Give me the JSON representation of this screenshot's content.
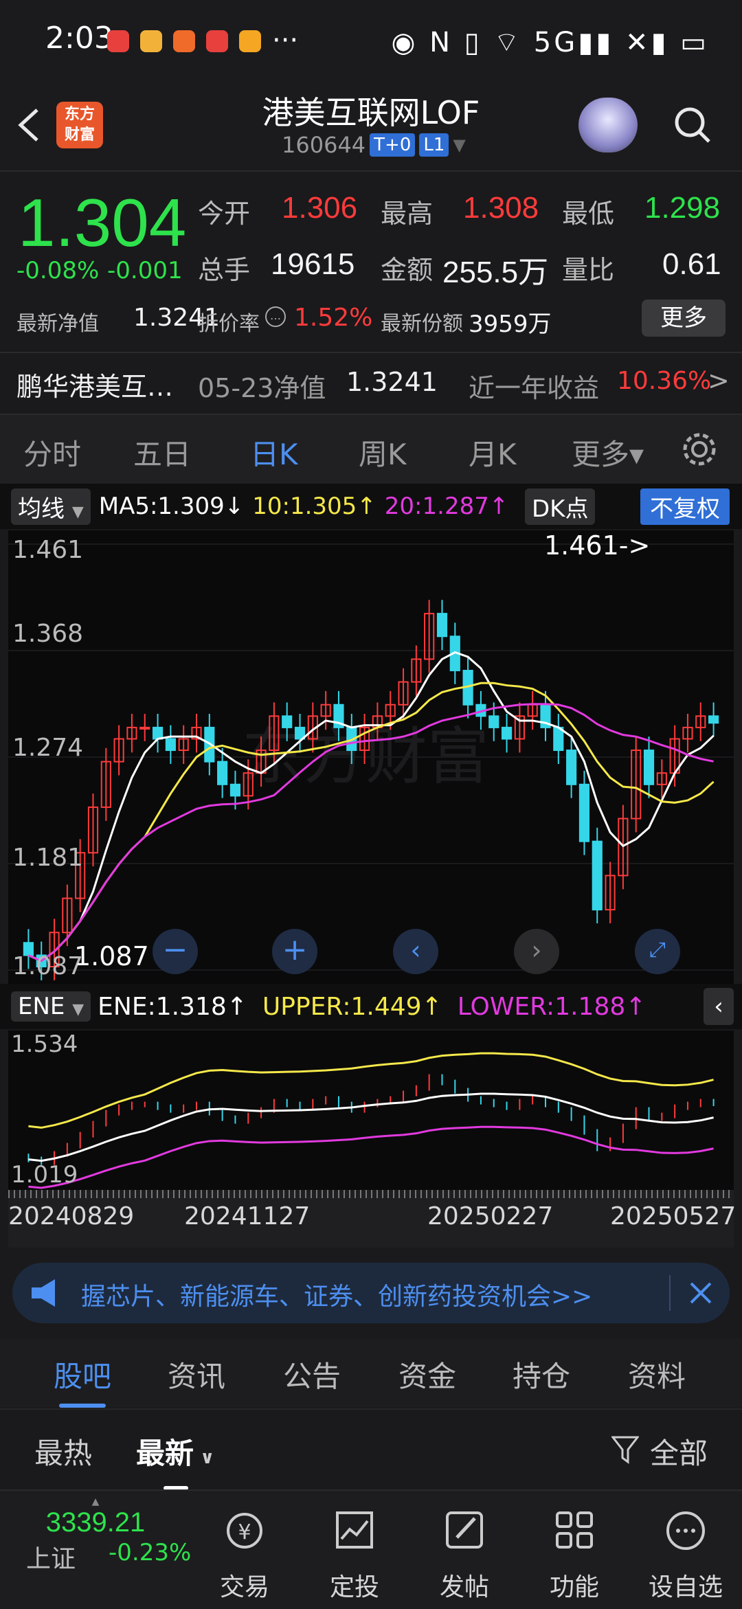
{
  "status": {
    "time": "2:03",
    "dots": "···",
    "icons": "◉ N ▯ ⌔ 5G▮▮ ✕▮ ▭"
  },
  "header": {
    "title": "港美互联网LOF",
    "code": "160644",
    "tag1": "T+0",
    "tag2": "L1",
    "logo_line1": "东方",
    "logo_line2": "财富"
  },
  "quote": {
    "price": "1.304",
    "change_pct": "-0.08%",
    "change": "-0.001",
    "open_label": "今开",
    "open": "1.306",
    "high_label": "最高",
    "high": "1.308",
    "low_label": "最低",
    "low": "1.298",
    "vol_label": "总手",
    "vol": "19615",
    "amt_label": "金额",
    "amt": "255.5万",
    "ratio_label": "量比",
    "ratio": "0.61",
    "nav_label": "最新净值",
    "nav": "1.3241",
    "disc_label": "折价率",
    "disc": "1.52%",
    "share_label": "最新份额",
    "share": "3959万",
    "more": "更多",
    "fund_name": "鹏华港美互…",
    "nav_date_label": "05-23净值",
    "nav_date_val": "1.3241",
    "year_label": "近一年收益",
    "year_val": "10.36%",
    "arrow": ">"
  },
  "period_tabs": [
    "分时",
    "五日",
    "日K",
    "周K",
    "月K",
    "更多▾"
  ],
  "ma": {
    "sel": "均线",
    "ma5": "MA5:1.309↓",
    "ma10": "10:1.305↑",
    "ma20": "20:1.287↑",
    "dk": "DK点",
    "fq": "不复权"
  },
  "kchart": {
    "y_labels": [
      "1.461",
      "1.368",
      "1.274",
      "1.181",
      "1.087"
    ],
    "max_note": "1.461->",
    "min_note": "1.087",
    "watermark": "东方财富"
  },
  "ene": {
    "sel": "ENE",
    "ene": "ENE:1.318↑",
    "upper": "UPPER:1.449↑",
    "lower": "LOWER:1.188↑",
    "y_top": "1.534",
    "y_bot": "1.019"
  },
  "dates": [
    "20240829",
    "20241127",
    "20250227",
    "20250527"
  ],
  "banner": {
    "text": "握芯片、新能源车、证券、创新药投资机会>>"
  },
  "bottom_tabs": [
    "股吧",
    "资讯",
    "公告",
    "资金",
    "持仓",
    "资料"
  ],
  "sort": {
    "hot": "最热",
    "new": "最新",
    "filter": "全部"
  },
  "nav": {
    "index_value": "3339.21",
    "index_name": "上证",
    "index_chg": "-0.23%",
    "items": [
      "交易",
      "定投",
      "发帖",
      "功能",
      "设自选"
    ]
  },
  "chart_data": {
    "type": "candlestick",
    "title": "",
    "ylim": [
      1.087,
      1.461
    ],
    "close": [
      1.1,
      1.09,
      1.12,
      1.15,
      1.19,
      1.23,
      1.27,
      1.29,
      1.3,
      1.3,
      1.29,
      1.28,
      1.29,
      1.3,
      1.27,
      1.25,
      1.24,
      1.26,
      1.28,
      1.31,
      1.3,
      1.29,
      1.31,
      1.32,
      1.3,
      1.28,
      1.3,
      1.31,
      1.32,
      1.34,
      1.36,
      1.4,
      1.38,
      1.35,
      1.32,
      1.31,
      1.3,
      1.29,
      1.31,
      1.32,
      1.3,
      1.28,
      1.25,
      1.2,
      1.14,
      1.17,
      1.22,
      1.28,
      1.25,
      1.26,
      1.29,
      1.3,
      1.31,
      1.304
    ]
  }
}
